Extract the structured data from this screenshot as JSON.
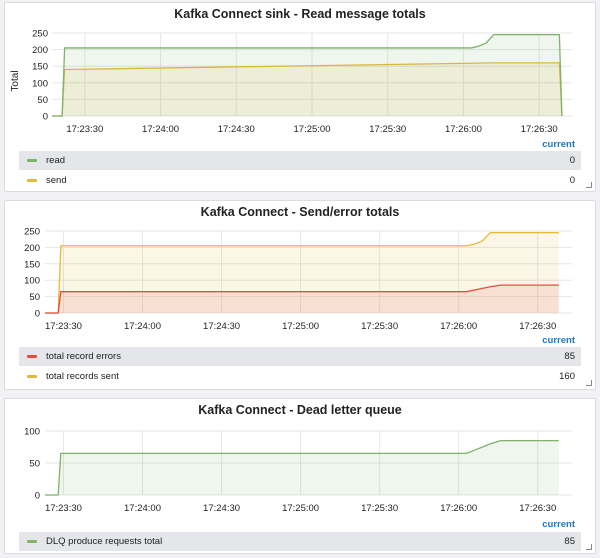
{
  "colors": {
    "green": "#7eb26d",
    "orange": "#eab839",
    "red": "#e24d42",
    "grid": "#e6e6e6"
  },
  "chart_data": [
    {
      "type": "line",
      "title": "Kafka Connect sink - Read message totals",
      "ylabel": "Total",
      "xlabel": "",
      "ylim": [
        0,
        250
      ],
      "yticks": [
        0,
        50,
        100,
        150,
        200,
        250
      ],
      "xlim": [
        "17:23:17",
        "17:26:43"
      ],
      "xticks": [
        "17:23:30",
        "17:24:00",
        "17:24:30",
        "17:25:00",
        "17:25:30",
        "17:26:00",
        "17:26:30"
      ],
      "legend_header": "current",
      "series": [
        {
          "name": "read",
          "color": "#7eb26d",
          "current": "0",
          "x": [
            "17:23:17",
            "17:23:21",
            "17:23:22",
            "17:26:03",
            "17:26:06",
            "17:26:09",
            "17:26:12",
            "17:26:38",
            "17:26:39"
          ],
          "y": [
            0,
            0,
            205,
            205,
            210,
            220,
            245,
            245,
            0
          ]
        },
        {
          "name": "send",
          "color": "#eab839",
          "current": "0",
          "x": [
            "17:23:17",
            "17:23:21",
            "17:23:22",
            "17:26:12",
            "17:26:38",
            "17:26:39"
          ],
          "y": [
            0,
            0,
            140,
            160,
            160,
            0
          ]
        }
      ]
    },
    {
      "type": "line",
      "title": "Kafka Connect - Send/error totals",
      "ylabel": "",
      "xlabel": "",
      "ylim": [
        0,
        250
      ],
      "yticks": [
        0,
        50,
        100,
        150,
        200,
        250
      ],
      "xlim": [
        "17:23:23",
        "17:26:43"
      ],
      "xticks": [
        "17:23:30",
        "17:24:00",
        "17:24:30",
        "17:25:00",
        "17:25:30",
        "17:26:00",
        "17:26:30"
      ],
      "legend_header": "current",
      "series": [
        {
          "name": "total record errors",
          "color": "#e24d42",
          "current": "85",
          "x": [
            "17:23:23",
            "17:23:28",
            "17:23:29",
            "17:26:03",
            "17:26:06",
            "17:26:09",
            "17:26:12",
            "17:26:16",
            "17:26:38"
          ],
          "y": [
            0,
            0,
            65,
            65,
            70,
            75,
            80,
            85,
            85
          ]
        },
        {
          "name": "total records sent",
          "color": "#eab839",
          "current": "160",
          "x": [
            "17:23:23",
            "17:23:28",
            "17:23:29",
            "17:26:03",
            "17:26:06",
            "17:26:09",
            "17:26:12",
            "17:26:38"
          ],
          "y": [
            0,
            0,
            205,
            205,
            210,
            220,
            245,
            245
          ]
        }
      ]
    },
    {
      "type": "line",
      "title": "Kafka Connect - Dead letter queue",
      "ylabel": "",
      "xlabel": "",
      "ylim": [
        0,
        100
      ],
      "yticks": [
        0,
        50,
        100
      ],
      "xlim": [
        "17:23:23",
        "17:26:43"
      ],
      "xticks": [
        "17:23:30",
        "17:24:00",
        "17:24:30",
        "17:25:00",
        "17:25:30",
        "17:26:00",
        "17:26:30"
      ],
      "legend_header": "current",
      "series": [
        {
          "name": "DLQ produce requests total",
          "color": "#7eb26d",
          "current": "85",
          "x": [
            "17:23:23",
            "17:23:28",
            "17:23:29",
            "17:26:03",
            "17:26:06",
            "17:26:09",
            "17:26:12",
            "17:26:16",
            "17:26:38"
          ],
          "y": [
            0,
            0,
            65,
            65,
            70,
            75,
            80,
            85,
            85
          ]
        }
      ]
    }
  ]
}
